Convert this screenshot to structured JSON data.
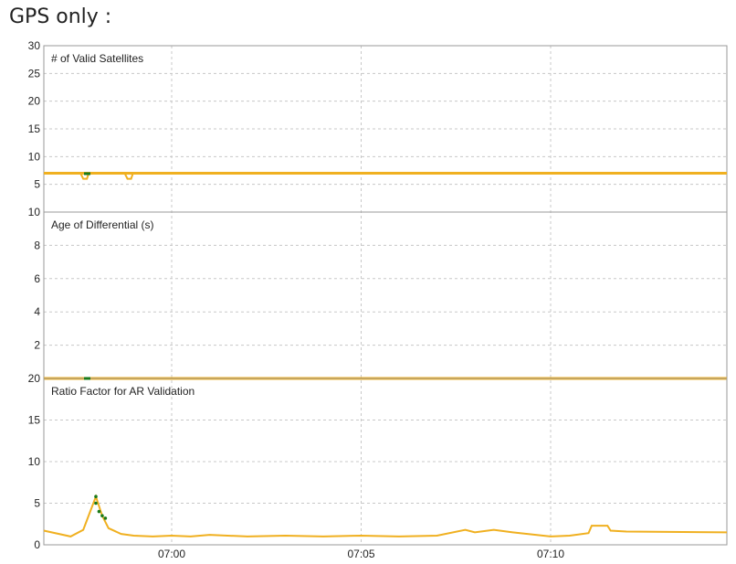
{
  "page": {
    "title": "GPS only :"
  },
  "chart_data": [
    {
      "type": "line",
      "title": "# of Valid Satellites",
      "ylim": [
        0,
        30
      ],
      "yticks": [
        30,
        25,
        20,
        15,
        10,
        5
      ],
      "grid": true,
      "color": "#f0b020",
      "series": [
        {
          "x": [
            "06:57:30",
            "06:58:00",
            "06:58:30",
            "06:59:00",
            "07:00:00",
            "07:05:00",
            "07:10:00",
            "07:12:20"
          ],
          "values": [
            7,
            7,
            7,
            7,
            7,
            7,
            7,
            7
          ]
        }
      ],
      "dips": [
        {
          "x": "06:57:40",
          "value": 6
        },
        {
          "x": "06:58:50",
          "value": 6
        }
      ]
    },
    {
      "type": "line",
      "title": "Age of Differential (s)",
      "ylim": [
        0,
        10
      ],
      "yticks": [
        10,
        8,
        6,
        4,
        2
      ],
      "grid": true,
      "color": "#f0b020",
      "series": [
        {
          "x": [
            "06:57:30",
            "07:12:20"
          ],
          "values": [
            0,
            0
          ]
        }
      ]
    },
    {
      "type": "line",
      "title": "Ratio Factor for AR Validation",
      "ylim": [
        0,
        20
      ],
      "yticks": [
        20,
        15,
        10,
        5,
        0
      ],
      "grid": true,
      "color": "#f0b020",
      "highlight_color": "#1a7a1a",
      "xticks": [
        "07:00",
        "07:05",
        "07:10"
      ],
      "series": [
        {
          "x": [
            "06:57:00",
            "06:57:20",
            "06:57:40",
            "06:58:00",
            "06:58:10",
            "06:58:20",
            "06:58:40",
            "06:59:00",
            "06:59:30",
            "07:00:00",
            "07:00:30",
            "07:01:00",
            "07:02:00",
            "07:03:00",
            "07:04:00",
            "07:05:00",
            "07:06:00",
            "07:07:00",
            "07:07:45",
            "07:08:00",
            "07:08:30",
            "07:09:00",
            "07:10:00",
            "07:10:30",
            "07:11:00",
            "07:11:05",
            "07:11:30",
            "07:11:35",
            "07:12:00",
            "07:12:20"
          ],
          "values": [
            1.7,
            1.0,
            1.8,
            5.8,
            3.5,
            2.0,
            1.3,
            1.1,
            1.0,
            1.1,
            1.0,
            1.2,
            1.0,
            1.1,
            1.0,
            1.1,
            1.0,
            1.1,
            1.8,
            1.5,
            1.8,
            1.5,
            1.0,
            1.1,
            1.4,
            2.3,
            2.3,
            1.7,
            1.6,
            1.5
          ]
        }
      ],
      "highlight_points": [
        {
          "x": "06:58:00",
          "value": 5.8
        },
        {
          "x": "06:58:00",
          "value": 5.0
        },
        {
          "x": "06:58:05",
          "value": 4.0
        },
        {
          "x": "06:58:10",
          "value": 3.5
        },
        {
          "x": "06:58:15",
          "value": 3.2
        }
      ]
    }
  ]
}
